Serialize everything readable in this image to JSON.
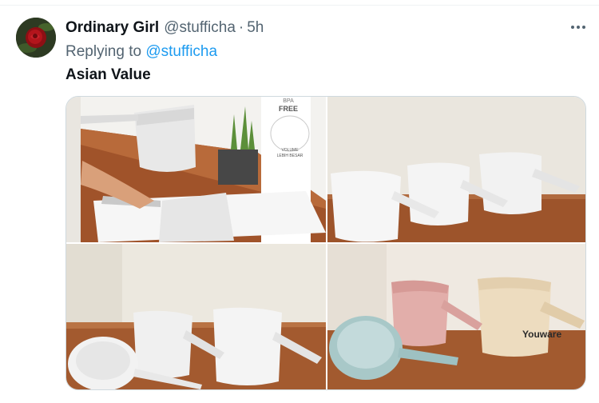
{
  "tweet": {
    "author_name": "Ordinary Girl",
    "handle": "@stufficha",
    "separator": "·",
    "time": "5h",
    "more_icon": "more-horizontal-icon",
    "replying_prefix": "Replying to",
    "replying_to": "@stufficha",
    "text": "Asian Value"
  },
  "media": {
    "image1": {
      "badge_top": "BPA",
      "badge_main": "FREE",
      "volume_label": "VOLUME",
      "volume_sub": "LEBIH BESAR"
    },
    "image4": {
      "brand": "Youware"
    }
  },
  "colors": {
    "text_primary": "#0f1419",
    "text_secondary": "#536471",
    "mention": "#1d9bf0",
    "border": "#cfd9de"
  }
}
